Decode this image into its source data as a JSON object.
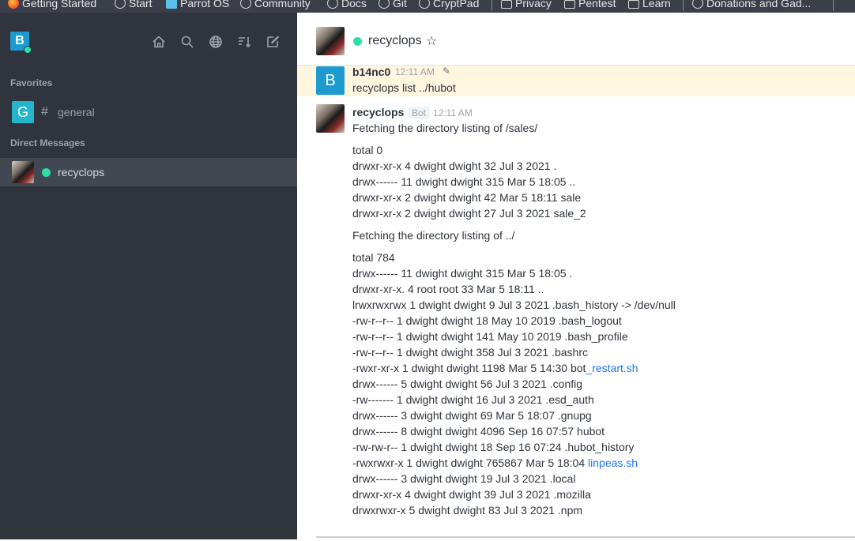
{
  "bookmarks": [
    {
      "label": "Getting Started",
      "icon": "firefox-icon"
    },
    {
      "label": "Start",
      "icon": "globe-icon"
    },
    {
      "label": "Parrot OS",
      "icon": "parrot-icon"
    },
    {
      "label": "Community",
      "icon": "globe-icon"
    },
    {
      "label": "Docs",
      "icon": "globe-icon"
    },
    {
      "label": "Git",
      "icon": "globe-icon"
    },
    {
      "label": "CryptPad",
      "icon": "globe-icon"
    },
    {
      "label": "Privacy",
      "icon": "folder-icon"
    },
    {
      "label": "Pentest",
      "icon": "folder-icon"
    },
    {
      "label": "Learn",
      "icon": "folder-icon"
    },
    {
      "label": "Donations and Gad...",
      "icon": "globe-icon"
    }
  ],
  "sidebar": {
    "workspace_initial": "B",
    "icons": [
      "home-icon",
      "search-icon",
      "directory-icon",
      "sort-icon",
      "create-new-icon"
    ],
    "favorites_title": "Favorites",
    "favorites": [
      {
        "initial": "G",
        "prefix": "#",
        "name": "general"
      }
    ],
    "dm_title": "Direct Messages",
    "dms": [
      {
        "name": "recyclops",
        "status": "online"
      }
    ]
  },
  "header": {
    "title": "recyclops",
    "star": "☆"
  },
  "messages": [
    {
      "avatar_initial": "B",
      "user": "b14nc0",
      "time": "12:11 AM",
      "edited_icon": "pencil-icon",
      "lines": [
        "recyclops list ../hubot"
      ]
    },
    {
      "user": "recyclops",
      "tag": "Bot",
      "time": "12:11 AM",
      "block1_title": "Fetching the directory listing of /sales/",
      "block1": [
        "total 0",
        "drwxr-xr-x 4 dwight dwight 32 Jul 3 2021 .",
        "drwx------ 11 dwight dwight 315 Mar 5 18:05 ..",
        "drwxr-xr-x 2 dwight dwight 42 Mar 5 18:11 sale",
        "drwxr-xr-x 2 dwight dwight 27 Jul 3 2021 sale_2"
      ],
      "block2_title": "Fetching the directory listing of ../",
      "block2": [
        "total 784",
        "drwx------ 11 dwight dwight 315 Mar 5 18:05 .",
        "drwxr-xr-x. 4 root root 33 Mar 5 18:11 ..",
        "lrwxrwxrwx 1 dwight dwight 9 Jul 3 2021 .bash_history -> /dev/null",
        "-rw-r--r-- 1 dwight dwight 18 May 10 2019 .bash_logout",
        "-rw-r--r-- 1 dwight dwight 141 May 10 2019 .bash_profile",
        "-rw-r--r-- 1 dwight dwight 358 Jul 3 2021 .bashrc"
      ],
      "line_bot_prefix": "-rwxr-xr-x 1 dwight dwight 1198 Mar 5 14:30 bot",
      "line_bot_link": "_restart.sh",
      "block3": [
        "drwx------ 5 dwight dwight 56 Jul 3 2021 .config",
        "-rw------- 1 dwight dwight 16 Jul 3 2021 .esd_auth",
        "drwx------ 3 dwight dwight 69 Mar 5 18:07 .gnupg",
        "drwx------ 8 dwight dwight 4096 Sep 16 07:57 hubot",
        "-rw-rw-r-- 1 dwight dwight 18 Sep 16 07:24 .hubot_history"
      ],
      "line_linpeas_prefix": "-rwxrwxr-x 1 dwight dwight 765867 Mar 5 18:04 ",
      "line_linpeas_link": "linpeas.sh",
      "block4": [
        "drwx------ 3 dwight dwight 19 Jul 3 2021 .local",
        "drwxr-xr-x 4 dwight dwight 39 Jul 3 2021 .mozilla",
        "drwxrwxr-x 5 dwight dwight 83 Jul 3 2021 .npm"
      ]
    }
  ],
  "colors": {
    "sidebar": "#2f343d",
    "online": "#2de0a5",
    "link": "#1d74f5",
    "highlight": "#fff6e0"
  }
}
